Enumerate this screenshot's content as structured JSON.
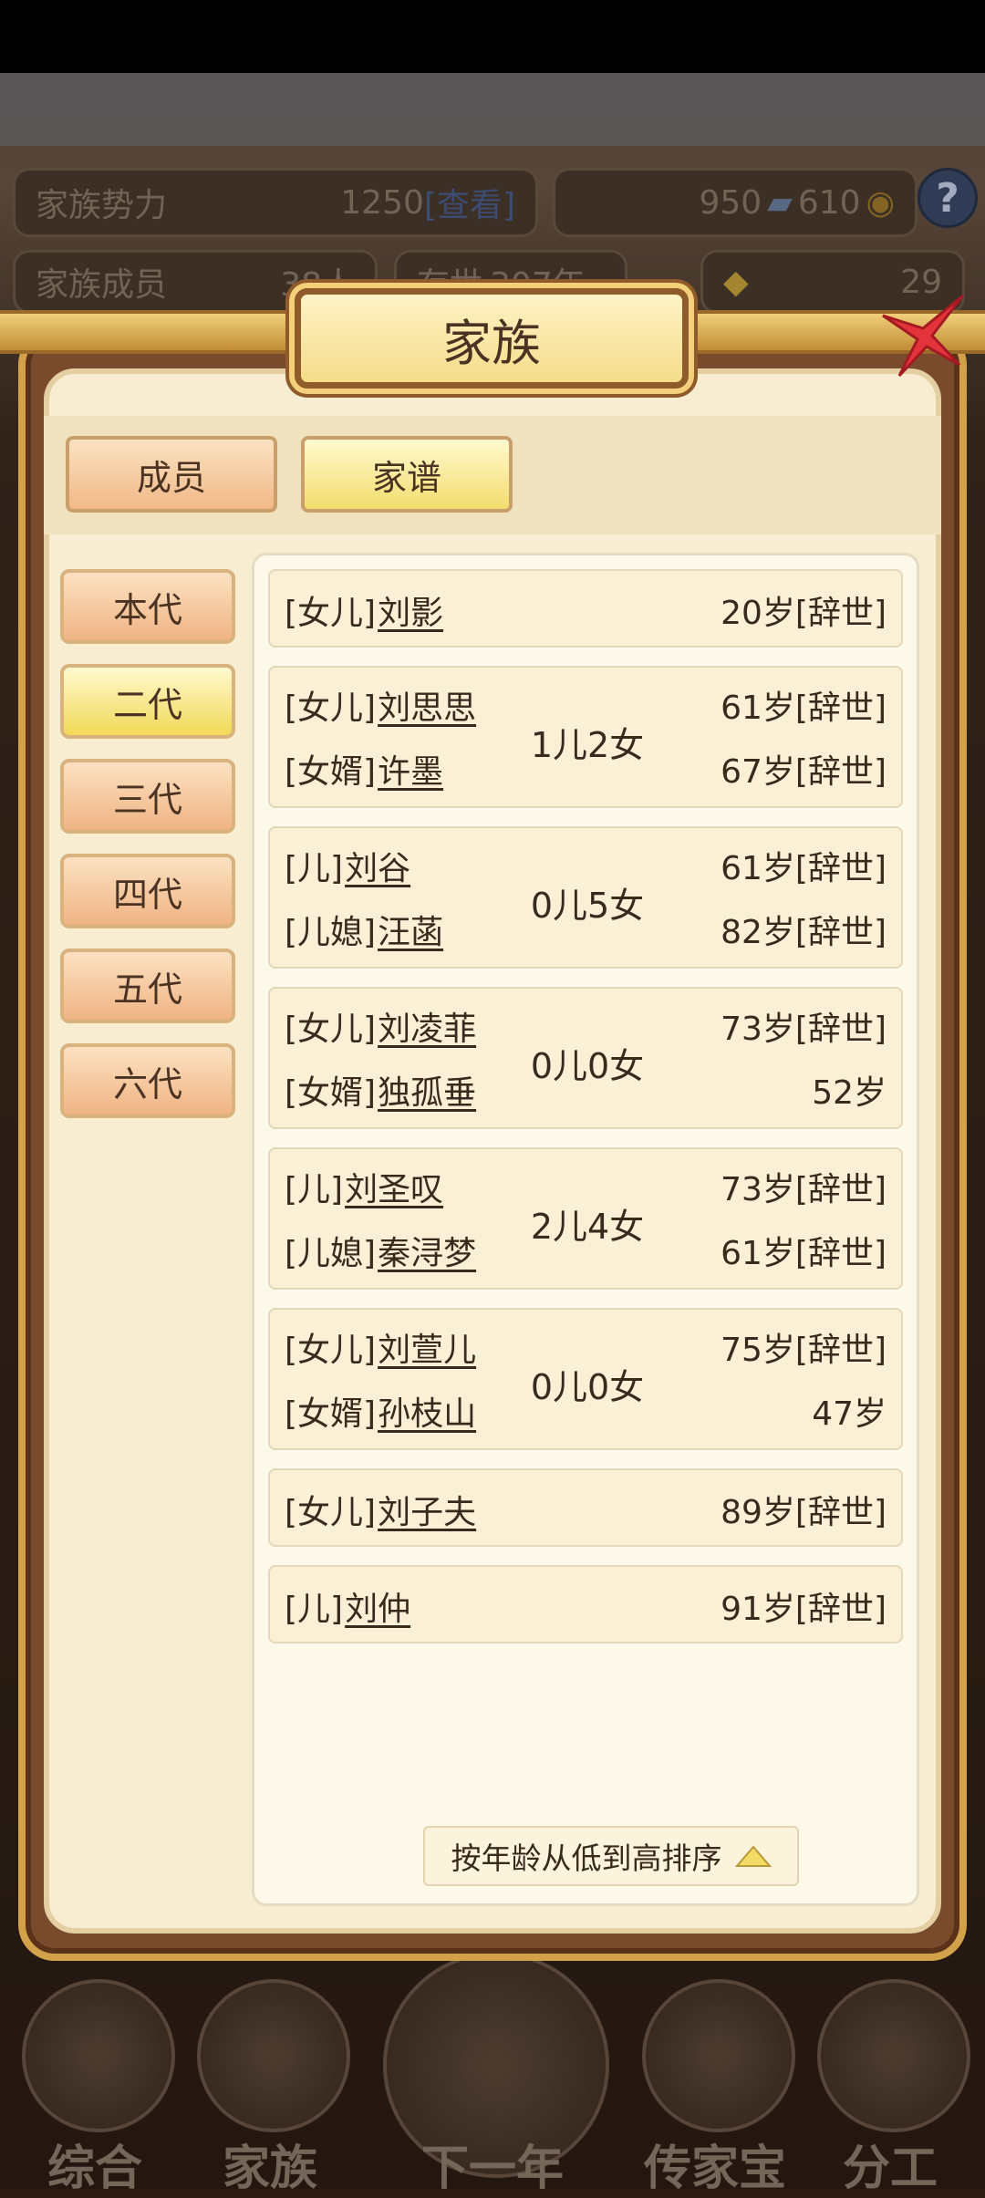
{
  "background": {
    "stats": {
      "power_label": "家族势力",
      "power_value": "1250",
      "power_link": "[查看]",
      "resources": "950",
      "resources2": "610",
      "members_label": "家族成员",
      "members_value": "38人",
      "exist_label": "存世",
      "exist_value": "307年",
      "gold_value": "29",
      "help_icon": "?"
    },
    "nav": [
      "综合",
      "家族",
      "下一年",
      "传家宝",
      "分工"
    ]
  },
  "modal": {
    "title": "家族",
    "close_icon": "close-icon",
    "tabs": [
      {
        "label": "成员",
        "active": false
      },
      {
        "label": "家谱",
        "active": true
      }
    ],
    "generations": [
      {
        "label": "本代",
        "active": false
      },
      {
        "label": "二代",
        "active": true
      },
      {
        "label": "三代",
        "active": false
      },
      {
        "label": "四代",
        "active": false
      },
      {
        "label": "五代",
        "active": false
      },
      {
        "label": "六代",
        "active": false
      }
    ],
    "members": [
      {
        "rows": [
          {
            "role": "[女儿]",
            "name": "刘影",
            "age": "20岁[辞世]"
          }
        ],
        "kids": ""
      },
      {
        "rows": [
          {
            "role": "[女儿]",
            "name": "刘思思",
            "age": "61岁[辞世]"
          },
          {
            "role": "[女婿]",
            "name": "许墨",
            "age": "67岁[辞世]"
          }
        ],
        "kids": "1儿2女"
      },
      {
        "rows": [
          {
            "role": "[儿]",
            "name": "刘谷",
            "age": "61岁[辞世]"
          },
          {
            "role": "[儿媳]",
            "name": "汪菡",
            "age": "82岁[辞世]"
          }
        ],
        "kids": "0儿5女"
      },
      {
        "rows": [
          {
            "role": "[女儿]",
            "name": "刘凌菲",
            "age": "73岁[辞世]"
          },
          {
            "role": "[女婿]",
            "name": "独孤垂",
            "age": "52岁"
          }
        ],
        "kids": "0儿0女"
      },
      {
        "rows": [
          {
            "role": "[儿]",
            "name": "刘圣叹",
            "age": "73岁[辞世]"
          },
          {
            "role": "[儿媳]",
            "name": "秦浔梦",
            "age": "61岁[辞世]"
          }
        ],
        "kids": "2儿4女"
      },
      {
        "rows": [
          {
            "role": "[女儿]",
            "name": "刘萱儿",
            "age": "75岁[辞世]"
          },
          {
            "role": "[女婿]",
            "name": "孙枝山",
            "age": "47岁"
          }
        ],
        "kids": "0儿0女"
      },
      {
        "rows": [
          {
            "role": "[女儿]",
            "name": "刘子夫",
            "age": "89岁[辞世]"
          }
        ],
        "kids": ""
      },
      {
        "rows": [
          {
            "role": "[儿]",
            "name": "刘仲",
            "age": "91岁[辞世]"
          }
        ],
        "kids": ""
      }
    ],
    "sort_label": "按年龄从低到高排序"
  }
}
